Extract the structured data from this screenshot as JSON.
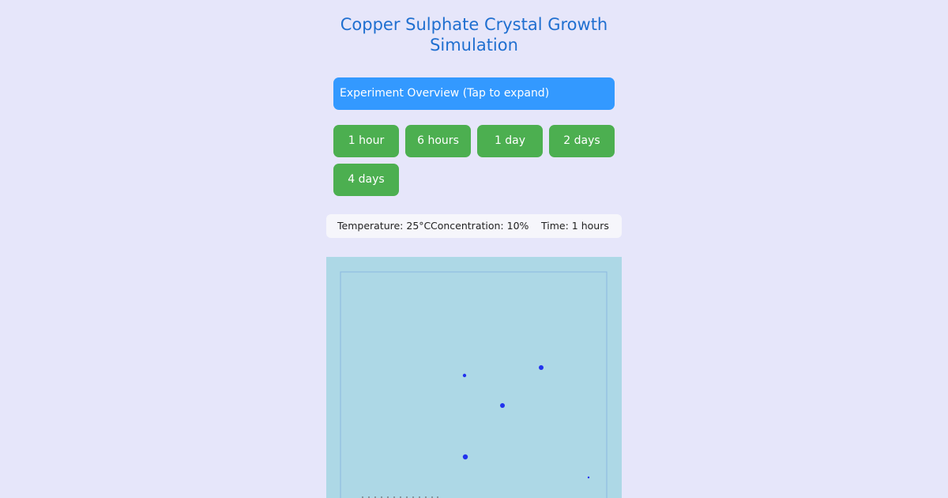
{
  "title_line1": "Copper Sulphate Crystal Growth",
  "title_line2": "Simulation",
  "overview": {
    "label": "Experiment Overview (Tap to expand)"
  },
  "time_buttons": [
    {
      "label": "1 hour"
    },
    {
      "label": "6 hours"
    },
    {
      "label": "1 day"
    },
    {
      "label": "2 days"
    },
    {
      "label": "4 days"
    }
  ],
  "status": {
    "temperature": "Temperature: 25°C",
    "concentration": "Concentration: 10%",
    "time": "Time: 1 hours"
  },
  "colors": {
    "background": "#e6e6fa",
    "title": "#1f6fd0",
    "overview_button": "#3399ff",
    "time_button": "#4caf50",
    "solution": "#add8e6",
    "crystal": "#2233ee"
  }
}
